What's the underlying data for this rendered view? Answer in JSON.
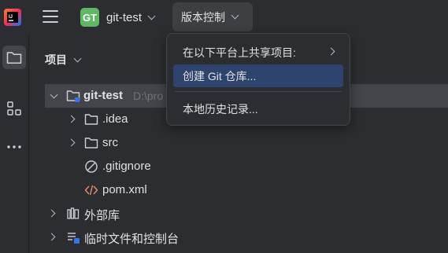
{
  "header": {
    "logo_icon": "intellij-idea-logo-icon",
    "main_menu_icon": "hamburger-menu-icon",
    "project": {
      "avatar": "GT",
      "name": "git-test",
      "avatar_color": "#5fb865"
    },
    "vcs_button": "版本控制"
  },
  "sidebar": {
    "items": [
      {
        "icon": "folder-icon",
        "active": true
      },
      {
        "icon": "structure-icon",
        "active": false
      },
      {
        "icon": "more-icon",
        "active": false
      }
    ]
  },
  "project_panel": {
    "title": "项目",
    "tree": [
      {
        "label": "git-test",
        "path": "D:\\pro",
        "icon": "module-folder-icon",
        "expanded": true,
        "selected": true
      },
      {
        "label": ".idea",
        "icon": "folder-icon",
        "expanded": false
      },
      {
        "label": "src",
        "icon": "folder-icon",
        "expanded": false
      },
      {
        "label": ".gitignore",
        "icon": "ignored-file-icon"
      },
      {
        "label": "pom.xml",
        "icon": "xml-file-icon"
      },
      {
        "label": "外部库",
        "icon": "library-icon",
        "expanded": false
      },
      {
        "label": "临时文件和控制台",
        "icon": "scratches-icon",
        "expanded": false
      }
    ]
  },
  "vcs_menu": {
    "items": [
      {
        "label": "在以下平台上共享项目:",
        "has_submenu": true
      },
      {
        "label": "创建 Git 仓库...",
        "highlighted": true
      },
      {
        "label": "本地历史记录...",
        "separator_before": true
      }
    ],
    "highlight_color": "#2e436e"
  }
}
